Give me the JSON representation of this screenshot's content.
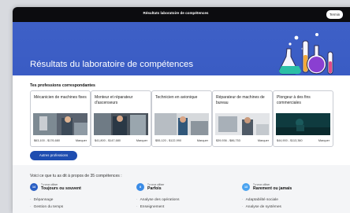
{
  "topbar": {
    "title": "Résultats laboratoire de compétences",
    "terminate_label": "Termin"
  },
  "banner": {
    "title": "Résultats du laboratoire de compétences"
  },
  "professions": {
    "heading": "Tes professions correspondantes",
    "cards": [
      {
        "title": "Mécanicien de machines fixes",
        "salary": "$63,100 - $176,680",
        "tag": "Marquer"
      },
      {
        "title": "Monteur et réparateur d'ascenseurs",
        "salary": "$41,800 - $147,680",
        "tag": "Marquer"
      },
      {
        "title": "Technicien en avionique",
        "salary": "$55,120 - $122,990",
        "tag": "Marquer"
      },
      {
        "title": "Réparateur de machines de bureau",
        "salary": "$39,936 - $86,753",
        "tag": "Marquer"
      },
      {
        "title": "Plongeur à des fins commerciales",
        "salary": "$44,900 - $113,360",
        "tag": "Marquer"
      }
    ],
    "more_label": "Autres professions"
  },
  "results": {
    "intro": "Voici ce que tu as dit à propos de 35 compétences :",
    "columns": [
      {
        "count": "14",
        "small": "Tu veux utiliser",
        "label": "Toujours ou souvent",
        "color": "#2a5fc4",
        "items": [
          "Dépannage",
          "Gestion du temps"
        ]
      },
      {
        "count": "8",
        "small": "Tu veux utiliser",
        "label": "Parfois",
        "color": "#3a8be6",
        "items": [
          "Analyse des opérations",
          "Enseignement"
        ]
      },
      {
        "count": "13",
        "small": "Tu veux utiliser",
        "label": "Rarement ou jamais",
        "color": "#4aa3f0",
        "items": [
          "Adaptabilité sociale",
          "Analyse de systèmes"
        ]
      }
    ]
  }
}
